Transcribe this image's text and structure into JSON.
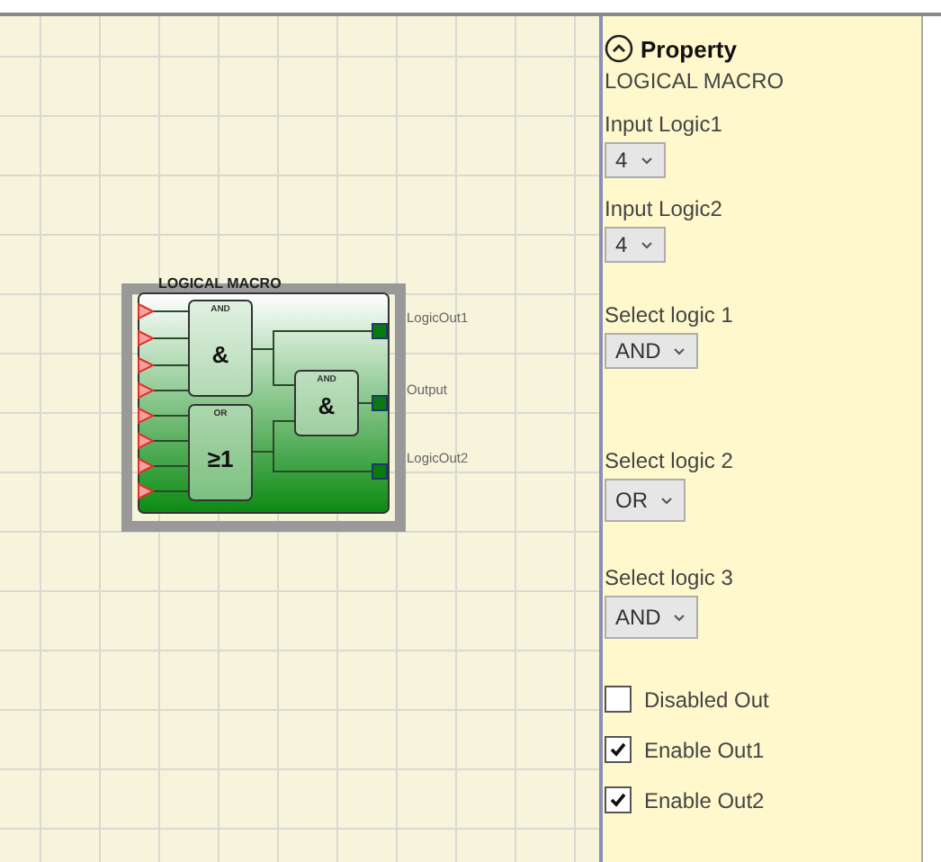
{
  "block": {
    "title": "LOGICAL MACRO",
    "gates": [
      {
        "type": "AND",
        "symbol": "&"
      },
      {
        "type": "OR",
        "symbol": "≥1"
      },
      {
        "type": "AND",
        "symbol": "&"
      }
    ],
    "outputs": [
      "LogicOut1",
      "Output",
      "LogicOut2"
    ]
  },
  "panel": {
    "title": "Property",
    "subtitle": "LOGICAL MACRO",
    "fields": [
      {
        "label": "Input Logic1",
        "value": "4"
      },
      {
        "label": "Input Logic2",
        "value": "4"
      },
      {
        "label": "Select logic 1",
        "value": "AND"
      },
      {
        "label": "Select logic 2",
        "value": "OR"
      },
      {
        "label": "Select logic 3",
        "value": "AND"
      }
    ],
    "checkboxes": [
      {
        "label": "Disabled Out",
        "checked": false
      },
      {
        "label": "Enable Out1",
        "checked": true
      },
      {
        "label": "Enable Out2",
        "checked": true
      }
    ]
  }
}
